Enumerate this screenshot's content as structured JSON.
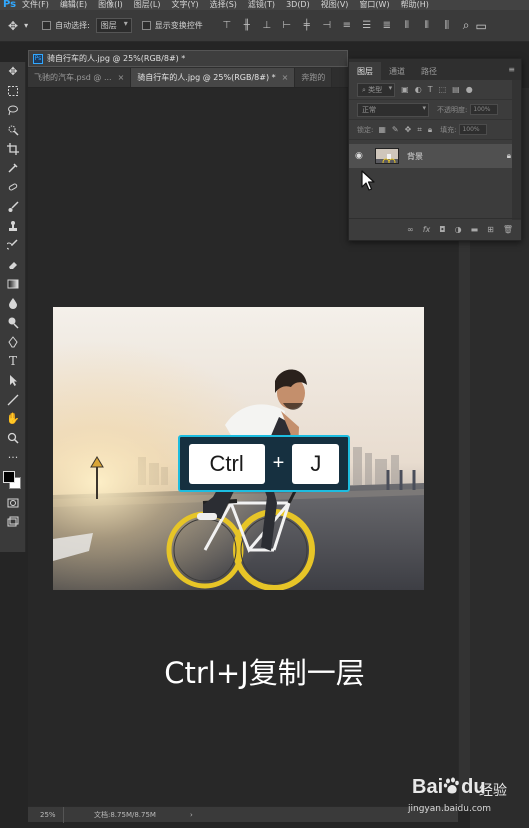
{
  "app": {
    "logo": "Ps"
  },
  "menu": [
    "文件(F)",
    "编辑(E)",
    "图像(I)",
    "图层(L)",
    "文字(Y)",
    "选择(S)",
    "滤镜(T)",
    "3D(D)",
    "视图(V)",
    "窗口(W)",
    "帮助(H)"
  ],
  "options": {
    "auto_select_label": "自动选择:",
    "auto_select_value": "图层",
    "show_transform_label": "显示变换控件"
  },
  "document": {
    "float_title": "骑自行车的人.jpg @ 25%(RGB/8#) *",
    "tabs": [
      {
        "label": "飞驰的汽车.psd @ ...",
        "close": "×"
      },
      {
        "label": "骑自行车的人.jpg @ 25%(RGB/8#) *",
        "close": "×"
      },
      {
        "label": "奔跑的"
      }
    ]
  },
  "layers_panel": {
    "tabs": [
      "图层",
      "通道",
      "路径"
    ],
    "filter_placeholder": "类型",
    "blend_mode": "正常",
    "opacity_label": "不透明度:",
    "opacity_value": "100%",
    "lock_label": "锁定:",
    "fill_label": "填充:",
    "fill_value": "100%",
    "layer_name": "背景"
  },
  "shortcut": {
    "key1": "Ctrl",
    "plus": "+",
    "key2": "J"
  },
  "caption": "Ctrl+J复制一层",
  "status": {
    "zoom": "25%",
    "doc_info": "文档:8.75M/8.75M",
    "arrow": "›"
  },
  "watermark": {
    "brand": "Bai",
    "brand2": "du",
    "cn": "经验",
    "url": "jingyan.baidu.com"
  }
}
